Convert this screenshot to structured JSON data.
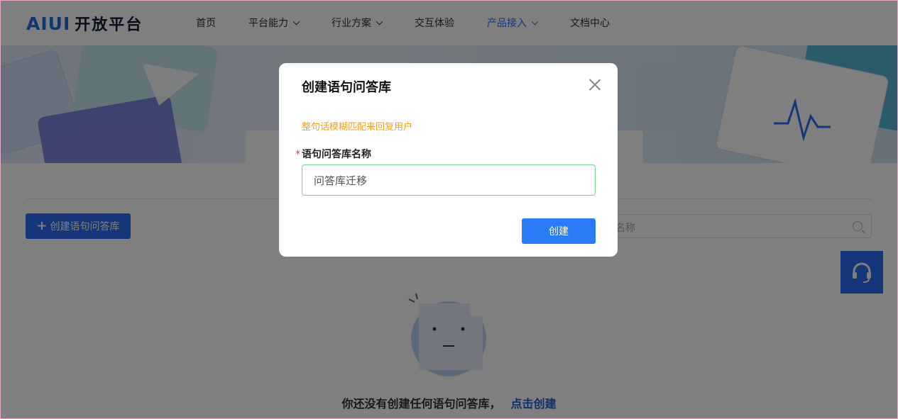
{
  "header": {
    "logo_mark": "AIUI",
    "logo_text": "开放平台",
    "nav": [
      {
        "label": "首页",
        "has_dropdown": false,
        "active": false
      },
      {
        "label": "平台能力",
        "has_dropdown": true,
        "active": false
      },
      {
        "label": "行业方案",
        "has_dropdown": true,
        "active": false
      },
      {
        "label": "交互体验",
        "has_dropdown": false,
        "active": false
      },
      {
        "label": "产品接入",
        "has_dropdown": true,
        "active": true
      },
      {
        "label": "文档中心",
        "has_dropdown": false,
        "active": false
      }
    ]
  },
  "toolbar": {
    "create_button_label": "创建语句问答库",
    "search_placeholder": "名称"
  },
  "empty_state": {
    "message": "你还没有创建任何语句问答库，",
    "action_link": "点击创建"
  },
  "modal": {
    "title": "创建语句问答库",
    "hint": "整句话模糊匹配来回复用户",
    "field_label": "语句问答库名称",
    "field_required_mark": "*",
    "field_value": "问答库迁移",
    "submit_label": "创建"
  },
  "colors": {
    "primary": "#2a6cf0",
    "hint": "#f0a020",
    "required": "#e53935",
    "input_focus_border": "#7fd18f",
    "overlay": "rgba(0,0,0,0.5)"
  }
}
